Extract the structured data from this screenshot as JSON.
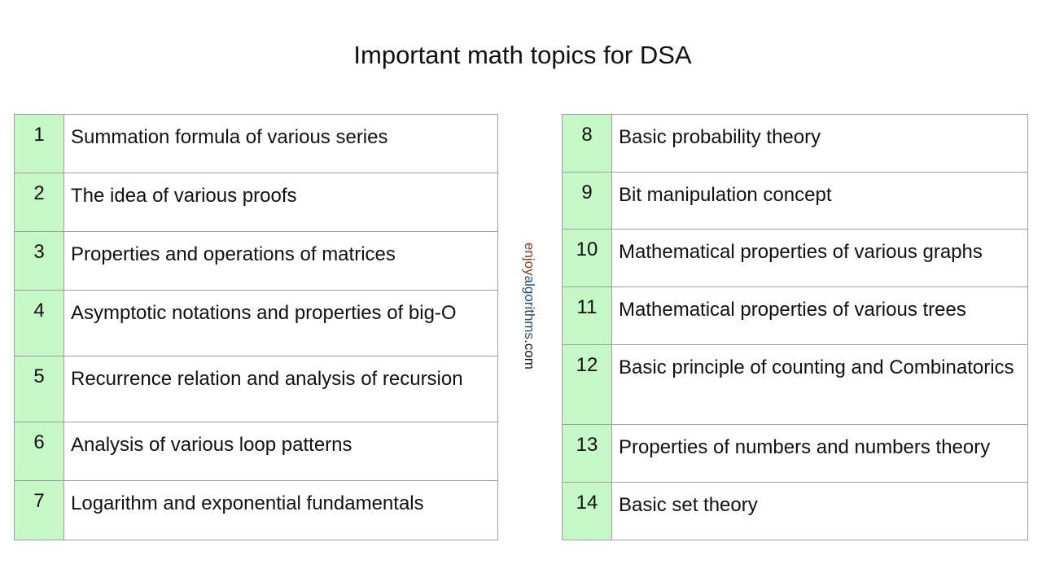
{
  "title": "Important math topics for DSA",
  "watermark": {
    "part1": "enjoy",
    "part2": "algorithms",
    "part3": ".com"
  },
  "left": [
    {
      "n": "1",
      "t": "Summation formula of various series"
    },
    {
      "n": "2",
      "t": "The idea of various proofs"
    },
    {
      "n": "3",
      "t": "Properties and operations of matrices"
    },
    {
      "n": "4",
      "t": "Asymptotic notations and properties of big-O"
    },
    {
      "n": "5",
      "t": "Recurrence relation and analysis of recursion"
    },
    {
      "n": "6",
      "t": "Analysis of various loop patterns"
    },
    {
      "n": "7",
      "t": "Logarithm and exponential fundamentals"
    }
  ],
  "right": [
    {
      "n": "8",
      "t": "Basic probability theory"
    },
    {
      "n": "9",
      "t": "Bit manipulation concept"
    },
    {
      "n": "10",
      "t": "Mathematical properties of various graphs"
    },
    {
      "n": "11",
      "t": "Mathematical properties of various trees"
    },
    {
      "n": "12",
      "t": "Basic principle of counting and Combinatorics"
    },
    {
      "n": "13",
      "t": "Properties of numbers and numbers theory"
    },
    {
      "n": "14",
      "t": "Basic set theory"
    }
  ]
}
